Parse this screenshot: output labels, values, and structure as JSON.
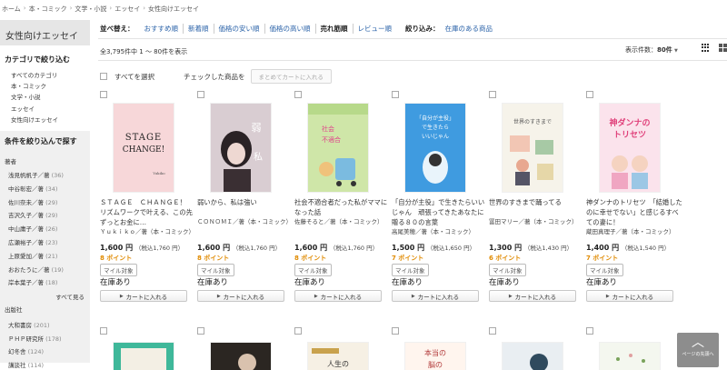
{
  "breadcrumb": [
    "ホーム",
    "本・コミック",
    "文学・小説",
    "エッセイ",
    "女性向けエッセイ"
  ],
  "sidebar": {
    "title": "女性向けエッセイ",
    "category_heading": "カテゴリで絞り込む",
    "categories": [
      "すべてのカテゴリ",
      "本・コミック",
      "文学・小説",
      "エッセイ",
      "女性向けエッセイ"
    ],
    "filter_heading": "条件を絞り込んで探す",
    "author_label": "著者",
    "authors": [
      {
        "name": "浅見帆帆子／著",
        "count": "(36)"
      },
      {
        "name": "中谷彰宏／著",
        "count": "(34)"
      },
      {
        "name": "佐川奈未／著",
        "count": "(29)"
      },
      {
        "name": "吉沢久子／著",
        "count": "(29)"
      },
      {
        "name": "中山庸子／著",
        "count": "(26)"
      },
      {
        "name": "広瀬裕子／著",
        "count": "(23)"
      },
      {
        "name": "上原愛加／著",
        "count": "(21)"
      },
      {
        "name": "おおたうに／著",
        "count": "(19)"
      },
      {
        "name": "岸本葉子／著",
        "count": "(18)"
      }
    ],
    "see_all": "すべて見る",
    "publisher_label": "出版社",
    "publishers": [
      {
        "name": "大和書房",
        "count": "(201)"
      },
      {
        "name": "ＰＨＰ研究所",
        "count": "(178)"
      },
      {
        "name": "幻冬舎",
        "count": "(124)"
      },
      {
        "name": "講談社",
        "count": "(114)"
      }
    ]
  },
  "sort": {
    "label": "並べ替え：",
    "options": [
      "おすすめ順",
      "新着順",
      "価格の安い順",
      "価格の高い順",
      "売れ筋順",
      "レビュー順"
    ],
    "filter_label": "絞り込み：",
    "filter_option": "在庫のある商品"
  },
  "results": {
    "count": "全3,795件中 1 ～ 80件を表示",
    "per_page_label": "表示件数：",
    "per_page_value": "80件",
    "select_all": "すべてを選択",
    "checked_label": "チェックした商品を",
    "add_all_cart": "まとめてカートに入れる"
  },
  "products": [
    {
      "title": "ＳＴＡＧＥ　ＣＨＡＮＧＥ！　リズムワークで叶える、この先ずっとお金に…",
      "author": "Ｙｕｋｉｋｏ／著（本・コミック）",
      "price": "1,600 円",
      "tax": "（税込1,760 円）",
      "points": "8 ポイント",
      "mile": "マイル対象",
      "stock": "在庫あり",
      "cart": "カートに入れる",
      "cover_text": "STAGE CHANGE!"
    },
    {
      "title": "弱いから、私は強い",
      "author": "ＣＯＮＯＭＩ／著（本・コミック）",
      "price": "1,600 円",
      "tax": "（税込1,760 円）",
      "points": "8 ポイント",
      "mile": "マイル対象",
      "stock": "在庫あり",
      "cart": "カートに入れる",
      "cover_text": "弱いから、私は強い"
    },
    {
      "title": "社会不適合者だった私がママになった話",
      "author": "佐藤そると／著（本・コミック）",
      "price": "1,600 円",
      "tax": "（税込1,760 円）",
      "points": "8 ポイント",
      "mile": "マイル対象",
      "stock": "在庫あり",
      "cart": "カートに入れる",
      "cover_text": ""
    },
    {
      "title": "「自分が主役」で生きたらいいじゃん　頑張ってきたあなたに贈る８０の言葉",
      "author": "高尾美穂／著（本・コミック）",
      "price": "1,500 円",
      "tax": "（税込1,650 円）",
      "points": "7 ポイント",
      "mile": "マイル対象",
      "stock": "在庫あり",
      "cart": "カートに入れる",
      "cover_text": "「自分が主役」で生きたらいいじゃん"
    },
    {
      "title": "世界のすきまで踊ってる",
      "author": "冨田マリー／著（本・コミック）",
      "price": "1,300 円",
      "tax": "（税込1,430 円）",
      "points": "6 ポイント",
      "mile": "マイル対象",
      "stock": "在庫あり",
      "cart": "カートに入れる",
      "cover_text": "世界のすきまで踊ってる"
    },
    {
      "title": "神ダンナのトリセツ　「結婚したのに幸せでない」と感じるすべての妻に！",
      "author": "蔵田真理子／著（本・コミック）",
      "price": "1,400 円",
      "tax": "（税込1,540 円）",
      "points": "7 ポイント",
      "mile": "マイル対象",
      "stock": "在庫あり",
      "cart": "カートに入れる",
      "cover_text": "神ダンナのトリセツ"
    }
  ],
  "back_to_top": "ページの先頭へ",
  "colors": {
    "link": "#2a62a8",
    "points": "#e08a00",
    "sidebar_bg": "#f0f0f0"
  }
}
